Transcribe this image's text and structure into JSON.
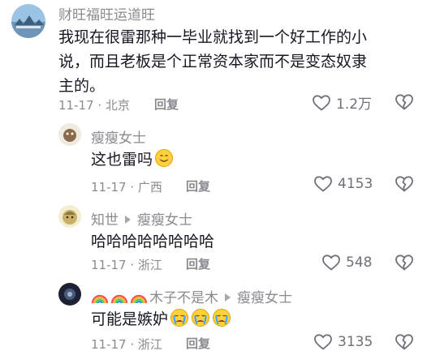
{
  "comments": [
    {
      "user": "财旺福旺运道旺",
      "text_lines": [
        "我现在很雷那种一毕业就找到一个好工作的小",
        "说，而且老板是个正常资本家而不是变态奴隶",
        "主的。"
      ],
      "date_loc": "11-17 · 北京",
      "reply_label": "回复",
      "likes": "1.2万"
    },
    {
      "user": "瘦瘦女士",
      "text": "这也雷吗",
      "emoji": "smile-emoji",
      "date_loc": "11-17 · 广西",
      "reply_label": "回复",
      "likes": "4153"
    },
    {
      "user": "知世",
      "reply_to": "瘦瘦女士",
      "text": "哈哈哈哈哈哈哈哈",
      "date_loc": "11-17 · 浙江",
      "reply_label": "回复",
      "likes": "548"
    },
    {
      "user_prefix_icons": [
        "rainbow-icon",
        "rainbow-icon",
        "rainbow-icon"
      ],
      "user": "木子不是木",
      "reply_to": "瘦瘦女士",
      "text": "可能是嫉妒",
      "emoji": [
        "crying-emoji",
        "crying-emoji",
        "crying-emoji"
      ],
      "date_loc": "11-17 · 浙江",
      "reply_label": "回复",
      "likes": "3135"
    }
  ],
  "colors": {
    "text": "#161823",
    "meta": "#8a8b91",
    "icon": "#6f7079"
  }
}
